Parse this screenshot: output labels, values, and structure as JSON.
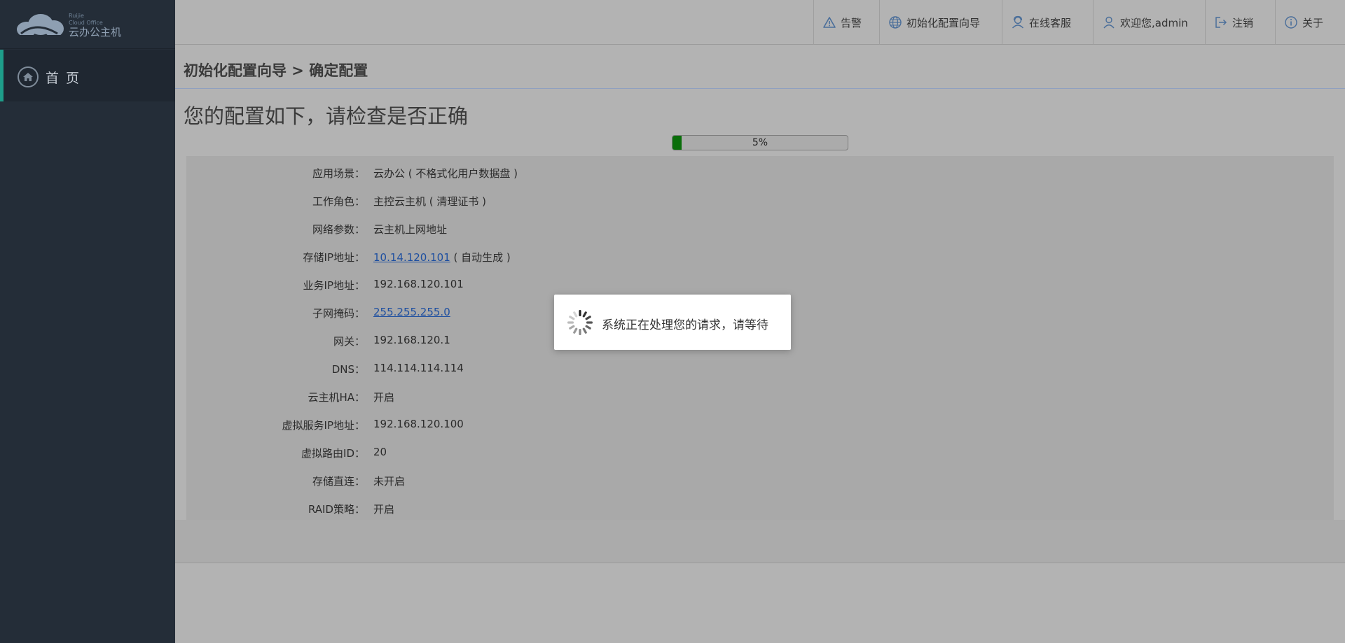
{
  "logo": {
    "sub_line1": "Ruijie",
    "sub_line2": "Cloud Office",
    "name": "云办公主机"
  },
  "sidebar": {
    "home_label": "首 页"
  },
  "header": {
    "items": [
      {
        "label": "告警",
        "icon": "alert-icon"
      },
      {
        "label": "初始化配置向导",
        "icon": "globe-icon"
      },
      {
        "label": "在线客服",
        "icon": "support-icon"
      },
      {
        "label": "欢迎您,admin",
        "icon": "user-icon"
      },
      {
        "label": "注销",
        "icon": "logout-icon"
      },
      {
        "label": "关于",
        "icon": "info-icon"
      }
    ]
  },
  "breadcrumb": "初始化配置向导 > 确定配置",
  "page_title": "您的配置如下，请检查是否正确",
  "progress": {
    "text": "5%",
    "value": 5
  },
  "config": [
    {
      "label": "应用场景：",
      "value": "云办公 ( 不格式化用户数据盘 )"
    },
    {
      "label": "工作角色：",
      "value": "主控云主机 ( 清理证书 )"
    },
    {
      "label": "网络参数：",
      "value": "云主机上网地址"
    },
    {
      "label": "存储IP地址：",
      "value": "10.14.120.101",
      "suffix": " ( 自动生成 )"
    },
    {
      "label": "业务IP地址：",
      "value": "192.168.120.101"
    },
    {
      "label": "子网掩码：",
      "value": "255.255.255.0"
    },
    {
      "label": "网关：",
      "value": "192.168.120.1"
    },
    {
      "label": "DNS：",
      "value": "114.114.114.114"
    },
    {
      "label": "云主机HA：",
      "value": "开启"
    },
    {
      "label": "虚拟服务IP地址：",
      "value": "192.168.120.100"
    },
    {
      "label": "虚拟路由ID：",
      "value": "20"
    },
    {
      "label": "存储直连：",
      "value": "未开启"
    },
    {
      "label": "RAID策略：",
      "value": "开启"
    }
  ],
  "modal": {
    "message": "系统正在处理您的请求，请等待"
  },
  "colors": {
    "sidebar": "#242d38",
    "accent": "#1e9e8a",
    "progress": "#0a6e0a",
    "link": "#1e4fa0"
  }
}
